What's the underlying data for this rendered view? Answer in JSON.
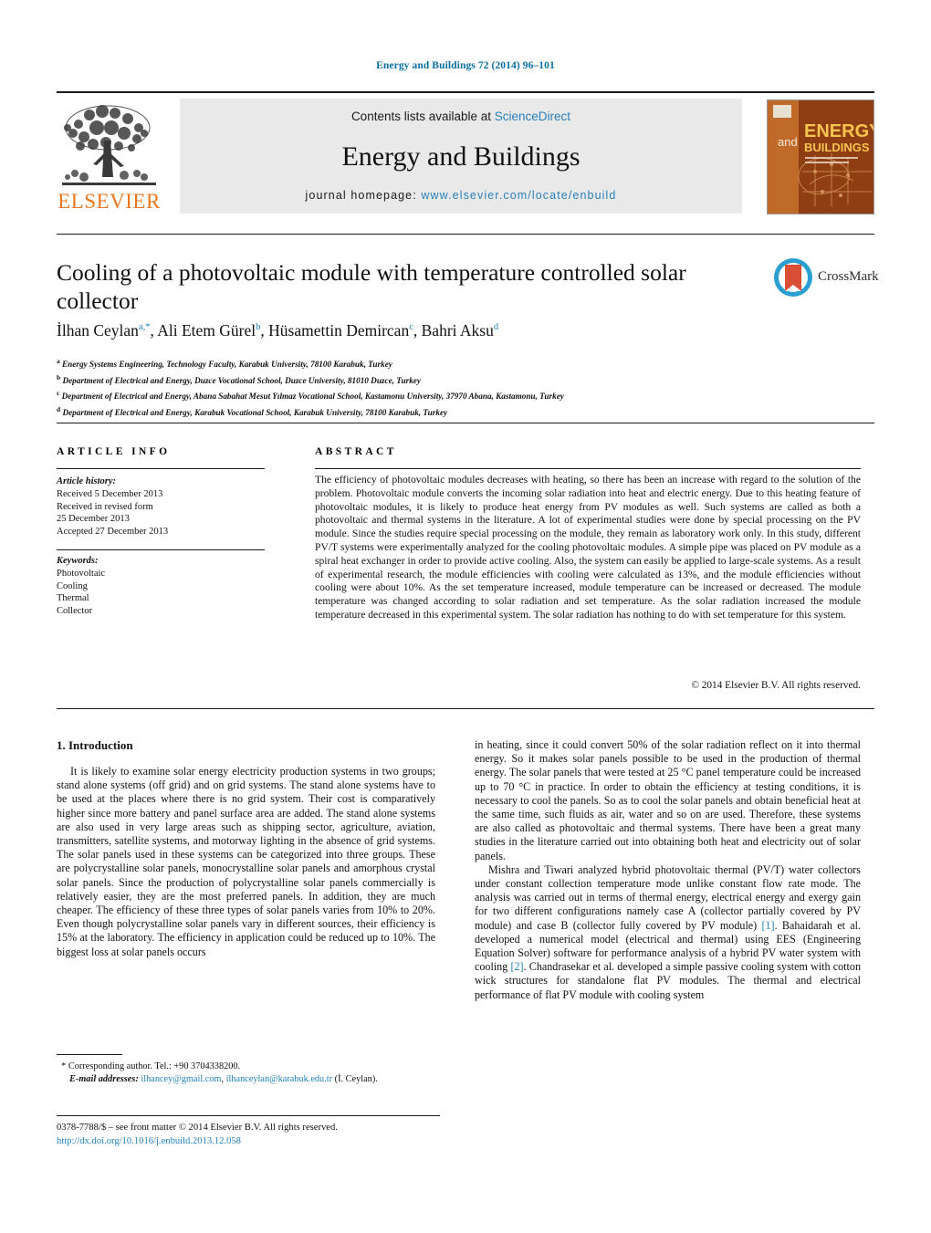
{
  "running_head": "Energy and Buildings 72 (2014) 96–101",
  "masthead": {
    "publisher_name": "ELSEVIER",
    "contents_prefix": "Contents lists available at ",
    "contents_link": "ScienceDirect",
    "journal_title": "Energy and Buildings",
    "homepage_label": "journal homepage: ",
    "homepage_url": "www.elsevier.com/locate/enbuild",
    "cover": {
      "line_and": "and",
      "line_energy": "ENERGY",
      "line_buildings": "BUILDINGS"
    }
  },
  "article": {
    "title": "Cooling of a photovoltaic module with temperature controlled solar collector",
    "crossmark_label": "CrossMark",
    "authors": [
      {
        "name": "İlhan Ceylan",
        "sup": "a,*"
      },
      {
        "name": "Ali Etem Gürel",
        "sup": "b"
      },
      {
        "name": "Hüsamettin Demircan",
        "sup": "c"
      },
      {
        "name": "Bahri Aksu",
        "sup": "d"
      }
    ],
    "affiliations": [
      {
        "mark": "a",
        "text": "Energy Systems Engineering, Technology Faculty, Karabuk University, 78100 Karabuk, Turkey"
      },
      {
        "mark": "b",
        "text": "Department of Electrical and Energy, Duzce Vocational School, Duzce University, 81010 Duzce, Turkey"
      },
      {
        "mark": "c",
        "text": "Department of Electrical and Energy, Abana Sabahat Mesut Yılmaz Vocational School, Kastamonu University, 37970 Abana, Kastamonu, Turkey"
      },
      {
        "mark": "d",
        "text": "Department of Electrical and Energy, Karabuk Vocational School, Karabuk University, 78100 Karabuk, Turkey"
      }
    ]
  },
  "info": {
    "heading": "ARTICLE INFO",
    "history_label": "Article history:",
    "history_lines": [
      "Received 5 December 2013",
      "Received in revised form",
      "25 December 2013",
      "Accepted 27 December 2013"
    ],
    "keywords_label": "Keywords:",
    "keywords": [
      "Photovoltaic",
      "Cooling",
      "Thermal",
      "Collector"
    ]
  },
  "abstract": {
    "heading": "ABSTRACT",
    "text": "The efficiency of photovoltaic modules decreases with heating, so there has been an increase with regard to the solution of the problem. Photovoltaic module converts the incoming solar radiation into heat and electric energy. Due to this heating feature of photovoltaic modules, it is likely to produce heat energy from PV modules as well. Such systems are called as both a photovoltaic and thermal systems in the literature. A lot of experimental studies were done by special processing on the PV module. Since the studies require special processing on the module, they remain as laboratory work only. In this study, different PV/T systems were experimentally analyzed for the cooling photovoltaic modules. A simple pipe was placed on PV module as a spiral heat exchanger in order to provide active cooling. Also, the system can easily be applied to large-scale systems. As a result of experimental research, the module efficiencies with cooling were calculated as 13%, and the module efficiencies without cooling were about 10%. As the set temperature increased, module temperature can be increased or decreased. The module temperature was changed according to solar radiation and set temperature. As the solar radiation increased the module temperature decreased in this experimental system. The solar radiation has nothing to do with set temperature for this system.",
    "copyright": "© 2014 Elsevier B.V. All rights reserved."
  },
  "body": {
    "section_number_title": "1.  Introduction",
    "left_paragraph": "It is likely to examine solar energy electricity production systems in two groups; stand alone systems (off grid) and on grid systems. The stand alone systems have to be used at the places where there is no grid system. Their cost is comparatively higher since more battery and panel surface area are added. The stand alone systems are also used in very large areas such as shipping sector, agriculture, aviation, transmitters, satellite systems, and motorway lighting in the absence of grid systems. The solar panels used in these systems can be categorized into three groups. These are polycrystalline solar panels, monocrystalline solar panels and amorphous crystal solar panels. Since the production of polycrystalline solar panels commercially is relatively easier, they are the most preferred panels. In addition, they are much cheaper. The efficiency of these three types of solar panels varies from 10% to 20%. Even though polycrystalline solar panels vary in different sources, their efficiency is 15% at the laboratory. The efficiency in application could be reduced up to 10%. The biggest loss at solar panels occurs",
    "right_paragraph_1": "in heating, since it could convert 50% of the solar radiation reflect on it into thermal energy. So it makes solar panels possible to be used in the production of thermal energy. The solar panels that were tested at 25 °C panel temperature could be increased up to 70 °C in practice. In order to obtain the efficiency at testing conditions, it is necessary to cool the panels. So as to cool the solar panels and obtain beneficial heat at the same time, such fluids as air, water and so on are used. Therefore, these systems are also called as photovoltaic and thermal systems. There have been a great many studies in the literature carried out into obtaining both heat and electricity out of solar panels.",
    "right_paragraph_2_a": "Mishra and Tiwari analyzed hybrid photovoltaic thermal (PV/T) water collectors under constant collection temperature mode unlike constant flow rate mode. The analysis was carried out in terms of thermal energy, electrical energy and exergy gain for two different configurations namely case A (collector partially covered by PV module) and case B (collector fully covered by PV module) ",
    "right_ref_1": "[1]",
    "right_paragraph_2_b": ". Bahaidarah et al. developed a numerical model (electrical and thermal) using EES (Engineering Equation Solver) software for performance analysis of a hybrid PV water system with cooling ",
    "right_ref_2": "[2]",
    "right_paragraph_2_c": ". Chandrasekar et al. developed a simple passive cooling system with cotton wick structures for standalone flat PV modules. The thermal and electrical performance of flat PV module with cooling system"
  },
  "footer": {
    "corresponding_mark": "*",
    "corresponding_text": "Corresponding author. Tel.: +90 3704338200.",
    "email_label": "E-mail addresses:",
    "email_1": "ilhancey@gmail.com",
    "email_sep": ", ",
    "email_2": "ilhanceylan@karabuk.edu.tr",
    "email_owner": " (İ. Ceylan).",
    "issn_line": "0378-7788/$ – see front matter © 2014 Elsevier B.V. All rights reserved.",
    "doi": "http://dx.doi.org/10.1016/j.enbuild.2013.12.058"
  },
  "colors": {
    "link_blue": "#1f7fb8",
    "elsevier_orange": "#E87722",
    "crossmark_blue": "#2b9fd1",
    "crossmark_red": "#d94f36",
    "banner_gray": "#e9e9e9"
  }
}
